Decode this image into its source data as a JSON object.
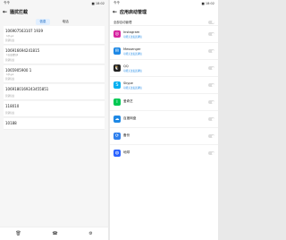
{
  "left": {
    "status_left": "令令",
    "status_right": "■ 18:02",
    "title": "骚扰拦截",
    "tabs": [
      "信息",
      "电话"
    ],
    "messages": [
      {
        "title": "106907563107 1939",
        "time": "",
        "body": "【孕子】",
        "cat": "营销短信"
      },
      {
        "title": "106916694241815",
        "time": "",
        "body": "【百度钱包】",
        "cat": "营销短信"
      },
      {
        "title": "1065905900 1",
        "time": "",
        "body": "【孕子】",
        "cat": "营销短信"
      },
      {
        "title": "1069180169243455851",
        "time": "",
        "body": "",
        "cat": "营销短信"
      },
      {
        "title": "118010",
        "time": "",
        "body": "",
        "cat": "营销短信"
      },
      {
        "title": "10188",
        "time": "",
        "body": "",
        "cat": ""
      }
    ],
    "bottom": [
      "",
      "",
      ""
    ]
  },
  "right": {
    "status_left": "令令",
    "status_right": "■ 18:02",
    "title": "应用启动管理",
    "desc": "",
    "toggle_label": "全部自动管理",
    "apps": [
      {
        "name": "Instagram",
        "status": "可能无法发送通知",
        "icon": "instagram-icon",
        "color": "#d6249f"
      },
      {
        "name": "Messenger",
        "status": "可能无法发送通知",
        "icon": "messenger-icon",
        "color": "#1e88e5"
      },
      {
        "name": "QQ",
        "status": "可能无法发送通知",
        "icon": "qq-icon",
        "color": "#222222"
      },
      {
        "name": "Skype",
        "status": "可能无法发送通知",
        "icon": "skype-icon",
        "color": "#00aff0"
      },
      {
        "name": "爱奇艺",
        "status": "",
        "icon": "iqiyi-icon",
        "color": "#00c853"
      },
      {
        "name": "百度网盘",
        "status": "",
        "icon": "baidu-pan-icon",
        "color": "#1e88e5"
      },
      {
        "name": "备份",
        "status": "",
        "icon": "backup-icon",
        "color": "#2f80ed"
      },
      {
        "name": "地球",
        "status": "",
        "icon": "globe-icon",
        "color": "#2962ff"
      }
    ]
  }
}
